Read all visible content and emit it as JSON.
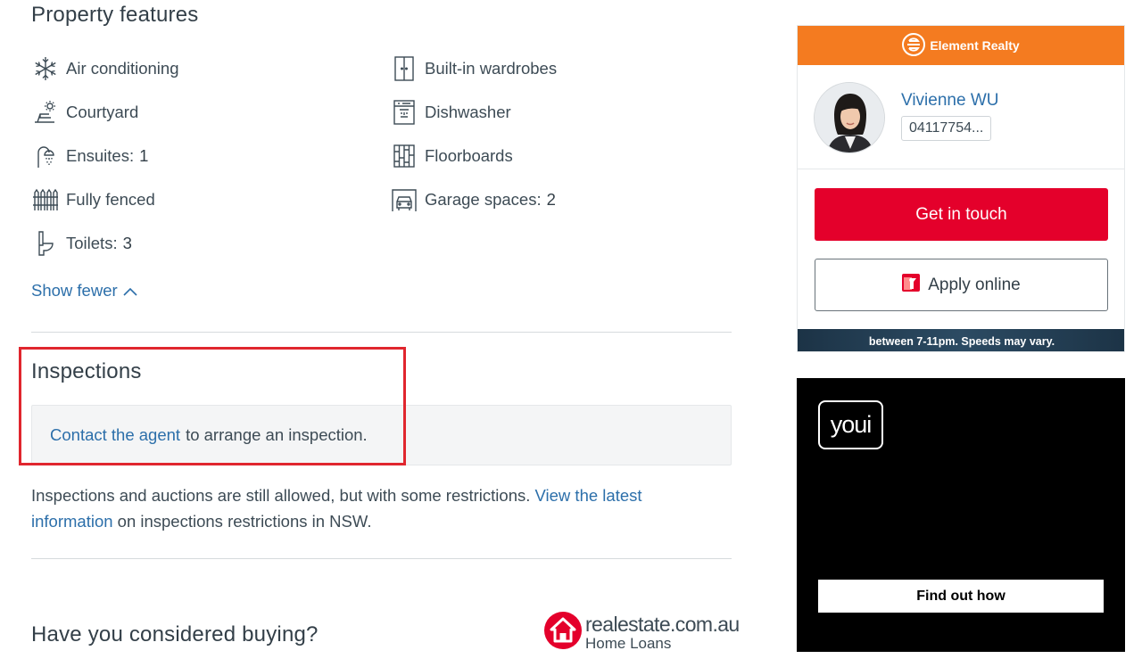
{
  "property_features": {
    "title": "Property features",
    "items": [
      {
        "label": "Air conditioning",
        "count": "",
        "icon": "snowflake-icon"
      },
      {
        "label": "Built-in wardrobes",
        "count": "",
        "icon": "wardrobe-icon"
      },
      {
        "label": "Courtyard",
        "count": "",
        "icon": "courtyard-icon"
      },
      {
        "label": "Dishwasher",
        "count": "",
        "icon": "dishwasher-icon"
      },
      {
        "label": "Ensuites:",
        "count": "1",
        "icon": "shower-icon"
      },
      {
        "label": "Floorboards",
        "count": "",
        "icon": "floorboards-icon"
      },
      {
        "label": "Fully fenced",
        "count": "",
        "icon": "fence-icon"
      },
      {
        "label": "Garage spaces:",
        "count": "2",
        "icon": "garage-icon"
      },
      {
        "label": "Toilets:",
        "count": "3",
        "icon": "toilet-icon"
      }
    ],
    "show_fewer": "Show fewer"
  },
  "inspections": {
    "title": "Inspections",
    "contact_link": "Contact the agent",
    "contact_text": "to arrange an inspection.",
    "notice_text": "Inspections and auctions are still allowed, but with some restrictions.",
    "notice_link": "View the latest information",
    "notice_suffix": "on inspections restrictions in NSW."
  },
  "buying": {
    "title": "Have you considered buying?",
    "logo_brand": "realestate.com.au",
    "logo_sub": "Home Loans"
  },
  "agent_card": {
    "agency": "Element Realty",
    "name": "Vivienne WU",
    "phone": "04117754...",
    "get_in_touch": "Get in touch",
    "apply_online": "Apply online",
    "ad_strip_text": "between 7-11pm. Speeds may vary."
  },
  "youi_ad": {
    "logo": "youi",
    "button": "Find out how"
  },
  "colors": {
    "link": "#2c6faa",
    "primary_button": "#e4002b",
    "agency": "#f47b20",
    "highlight": "#e0262e"
  }
}
